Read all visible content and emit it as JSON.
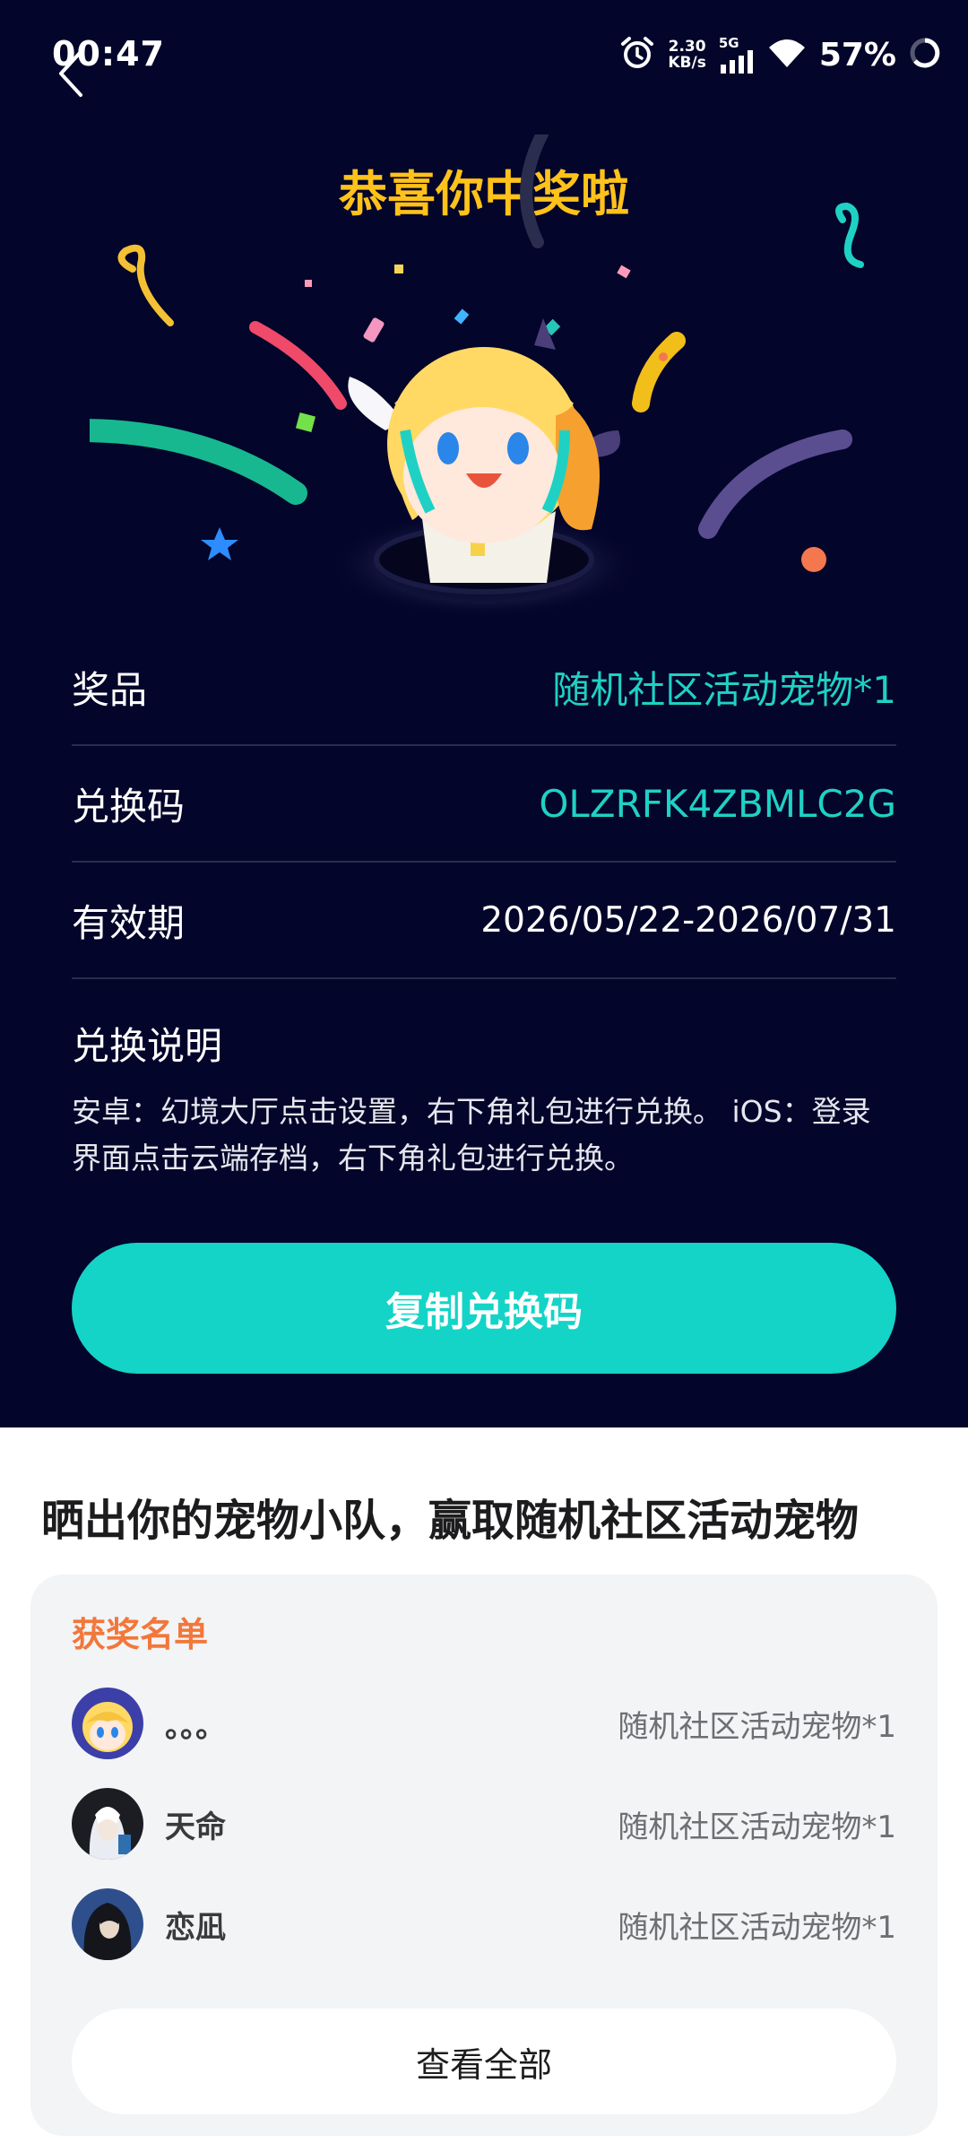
{
  "status_bar": {
    "time": "00:47",
    "net_speed_value": "2.30",
    "net_speed_unit": "KB/s",
    "network": "5G",
    "battery": "57%"
  },
  "header": {
    "title": "恭喜你中奖啦"
  },
  "details": {
    "prize_label": "奖品",
    "prize_value": "随机社区活动宠物*1",
    "code_label": "兑换码",
    "code_value": "OLZRFK4ZBMLC2G",
    "validity_label": "有效期",
    "validity_value": "2026/05/22-2026/07/31",
    "instructions_label": "兑换说明",
    "instructions_text": "安卓：幻境大厅点击设置，右下角礼包进行兑换。 iOS：登录界面点击云端存档，右下角礼包进行兑换。"
  },
  "copy_button": {
    "label": "复制兑换码"
  },
  "promo": {
    "headline": "晒出你的宠物小队，赢取随机社区活动宠物"
  },
  "winners": {
    "title": "获奖名单",
    "list": [
      {
        "name": "。。。",
        "prize": "随机社区活动宠物*1"
      },
      {
        "name": "天命",
        "prize": "随机社区活动宠物*1"
      },
      {
        "name": "恋凪",
        "prize": "随机社区活动宠物*1"
      }
    ],
    "view_all_label": "查看全部"
  },
  "colors": {
    "background_dark": "#04052a",
    "accent_teal": "#13d4c6",
    "title_yellow": "#ffc21a",
    "winners_orange": "#f2773a"
  }
}
